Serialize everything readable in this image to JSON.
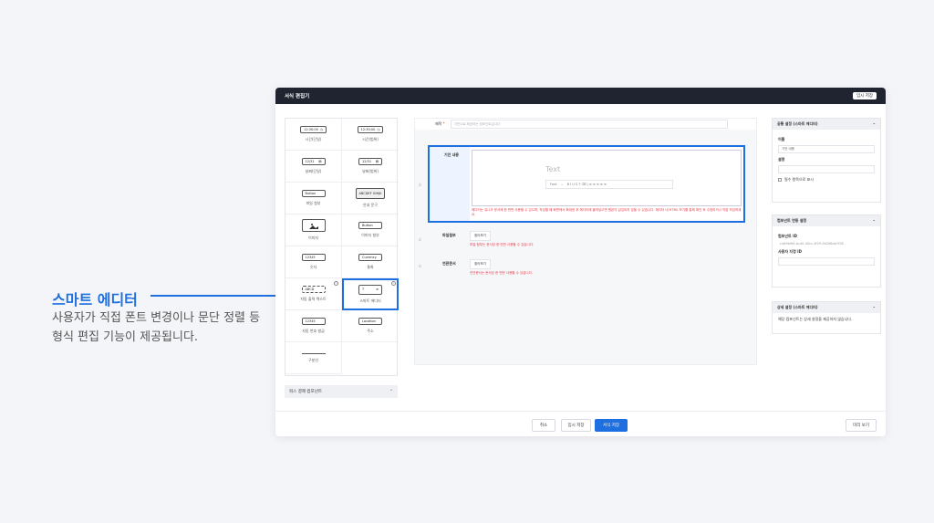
{
  "callout": {
    "title": "스마트 에디터",
    "description": "사용자가 직접 폰트 변경이나 문단 정렬 등 형식 편집 기능이 제공됩니다."
  },
  "window": {
    "title": "서식 편집기",
    "temp_button": "임시 저장",
    "palette": [
      {
        "chip": "12:30:00",
        "chip_icon": "clock-icon",
        "label": "시간(단일)"
      },
      {
        "chip": "12:30:00",
        "chip_icon": "clock-icon",
        "label": "시간(범위)"
      },
      {
        "chip": "12/31",
        "chip_icon": "calendar-icon",
        "label": "날짜(단일)"
      },
      {
        "chip": "12/31",
        "chip_icon": "calendar-icon",
        "label": "날짜(범위)"
      },
      {
        "chip": "Button",
        "chip_icon": "",
        "label": "파일 첨부"
      },
      {
        "chip": "ABCDEF GHIJK",
        "chip_icon": "",
        "label": "안내 문구"
      },
      {
        "chip": "",
        "chip_icon": "image-icon",
        "label": "이미지"
      },
      {
        "chip": "Button",
        "chip_icon": "",
        "label": "이미지 첨부"
      },
      {
        "chip": "12345",
        "chip_icon": "",
        "label": "숫자"
      },
      {
        "chip": "Currency",
        "chip_icon": "",
        "label": "통화"
      },
      {
        "chip": "ABCD",
        "chip_icon": "",
        "label": "자동 출력 텍스트"
      },
      {
        "chip": "T",
        "chip_icon": "",
        "label": "스마트 에디터"
      },
      {
        "chip": "12345",
        "chip_icon": "",
        "label": "자동 번호 발급"
      },
      {
        "chip": "Location",
        "chip_icon": "",
        "label": "주소"
      },
      {
        "chip": "",
        "chip_icon": "divider-icon",
        "label": "구분선"
      }
    ],
    "bottom_section": "워스 결제 컴포넌트",
    "form": {
      "title_label": "제목",
      "title_required": "*",
      "title_placeholder": "기안으로 제공되는 컴포넌트입니다",
      "editor_label": "기안 내용",
      "editor_placeholder": "Text",
      "toolbar_font": "Font",
      "toolbar_items": "B  I  U  S  T  ⌫  |  ≡  ≡  ≡  ≡  ≡",
      "editor_note": "에디터는 유니크 문서에 한 번만 사용할 수 있으며, 작성할 때 화면에서 확대한 후 에디터에 붙여넣으면 원본이 삽입되지 않을 수 있습니다. 에디터 내 HTML 보기를 통해 확인 후 수정하거나 직접 작성하세요.",
      "rows": [
        {
          "label": "파일첨부",
          "button": "찾아보기",
          "note": "파일 첨부는 문서당 한 번만 사용할 수 있습니다."
        },
        {
          "label": "연관문서",
          "button": "찾아보기",
          "note": "연관문서는 문서당 한 번만 사용할 수 있습니다."
        }
      ]
    },
    "right_panel": {
      "common": {
        "title": "공통 설정 (스마트 에디터)",
        "name_label": "이름",
        "name_value": "기안 내용",
        "desc_label": "설명",
        "required_check": "필수 항목으로 표시"
      },
      "component": {
        "title": "컴포넌트 연동 설정",
        "id_label": "컴포넌트 ID",
        "id_value": "c4d9b9f4-bc40-40cc-4f29-9d298ab7f28",
        "custom_label": "사용자 지정 ID"
      },
      "detail": {
        "title": "상세 설정 (스마트 에디터)",
        "text": "해당 컴포넌트는 상세 설정을 제공하지 않습니다."
      }
    },
    "footer": {
      "cancel": "취소",
      "temp_save": "임시 저장",
      "save": "서식 저장",
      "preview": "미리 보기"
    }
  }
}
